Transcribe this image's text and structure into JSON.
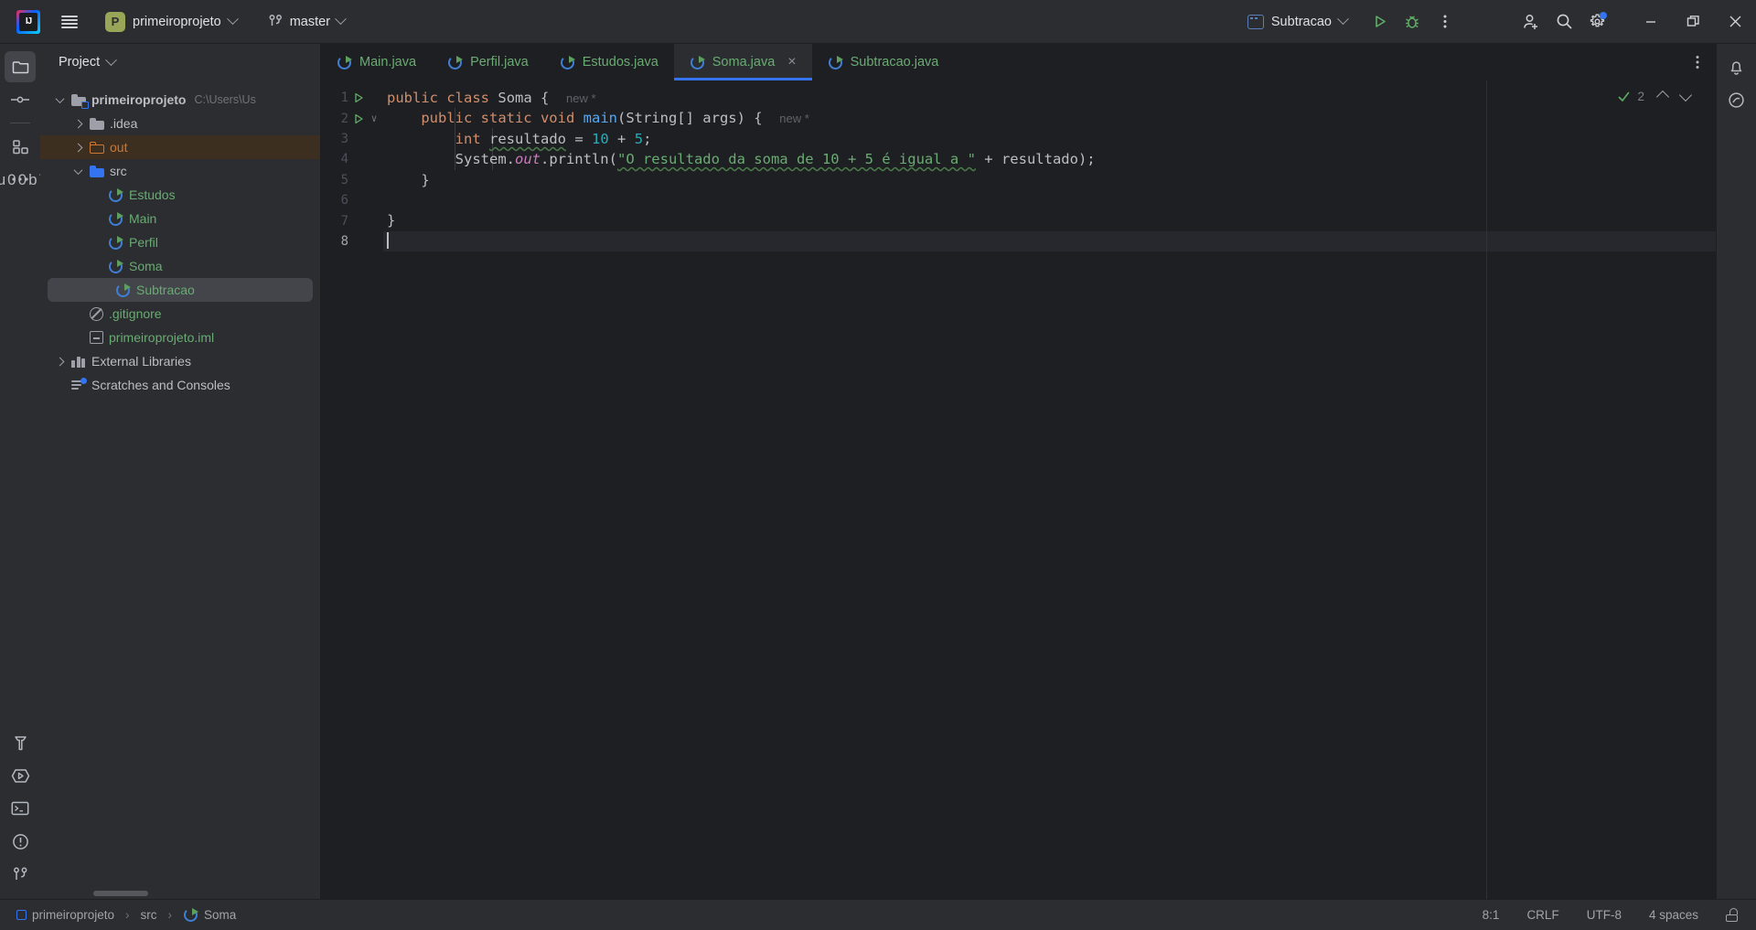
{
  "titlebar": {
    "logo_name": "intellij-idea-logo",
    "menu_label": "main-menu",
    "project_badge": "P",
    "project_name": "primeiroprojeto",
    "branch_name": "master",
    "run_config": "Subtracao",
    "run_label": "Run",
    "debug_label": "Debug",
    "more_label": "More Actions",
    "account_label": "Account",
    "search_label": "Search Everywhere",
    "settings_label": "Settings",
    "minimize_label": "Minimize",
    "maximize_label": "Maximize",
    "close_label": "Close"
  },
  "left_rail": {
    "top": [
      {
        "name": "project-tool-window",
        "icon": "folder-icon",
        "active": true
      },
      {
        "name": "commit-tool-window",
        "icon": "commit-icon",
        "active": false
      },
      {
        "name": "structure-tool-window",
        "icon": "structure-icon",
        "active": false
      },
      {
        "name": "more-tool-windows",
        "icon": "ellipsis-icon",
        "active": false
      }
    ],
    "bottom": [
      {
        "name": "build-tool-window",
        "icon": "hammer-icon"
      },
      {
        "name": "run-tool-window",
        "icon": "run-icon"
      },
      {
        "name": "terminal-tool-window",
        "icon": "terminal-icon"
      },
      {
        "name": "problems-tool-window",
        "icon": "warning-icon"
      },
      {
        "name": "version-control-tool-window",
        "icon": "branch-icon"
      }
    ]
  },
  "right_rail": [
    {
      "name": "notifications-tool-window",
      "icon": "bell-icon"
    },
    {
      "name": "ai-assistant-tool-window",
      "icon": "ai-icon"
    }
  ],
  "project_panel": {
    "title": "Project",
    "tree": [
      {
        "label": "primeiroprojeto",
        "suffix": "C:\\Users\\Us",
        "depth": 0,
        "icon": "module-folder-icon",
        "twisty": "open",
        "color": "grey",
        "state": "normal",
        "bold": true
      },
      {
        "label": ".idea",
        "suffix": "",
        "depth": 1,
        "icon": "folder-icon",
        "twisty": "closed",
        "color": "grey",
        "state": "normal",
        "bold": false
      },
      {
        "label": "out",
        "suffix": "",
        "depth": 1,
        "icon": "folder-orange-icon",
        "twisty": "closed",
        "color": "orange",
        "state": "highlighted",
        "bold": false
      },
      {
        "label": "src",
        "suffix": "",
        "depth": 1,
        "icon": "folder-blue-icon",
        "twisty": "open",
        "color": "grey",
        "state": "normal",
        "bold": false
      },
      {
        "label": "Estudos",
        "suffix": "",
        "depth": 2,
        "icon": "java-class-icon",
        "twisty": "none",
        "color": "green",
        "state": "normal",
        "bold": false
      },
      {
        "label": "Main",
        "suffix": "",
        "depth": 2,
        "icon": "java-class-icon",
        "twisty": "none",
        "color": "green",
        "state": "normal",
        "bold": false
      },
      {
        "label": "Perfil",
        "suffix": "",
        "depth": 2,
        "icon": "java-class-icon",
        "twisty": "none",
        "color": "green",
        "state": "normal",
        "bold": false
      },
      {
        "label": "Soma",
        "suffix": "",
        "depth": 2,
        "icon": "java-class-icon",
        "twisty": "none",
        "color": "green",
        "state": "normal",
        "bold": false
      },
      {
        "label": "Subtracao",
        "suffix": "",
        "depth": 2,
        "icon": "java-class-icon",
        "twisty": "none",
        "color": "green",
        "state": "selected",
        "bold": false
      },
      {
        "label": ".gitignore",
        "suffix": "",
        "depth": 1,
        "icon": "gitignore-icon",
        "twisty": "none",
        "color": "green",
        "state": "normal",
        "bold": false
      },
      {
        "label": "primeiroprojeto.iml",
        "suffix": "",
        "depth": 1,
        "icon": "iml-icon",
        "twisty": "none",
        "color": "green",
        "state": "normal",
        "bold": false
      },
      {
        "label": "External Libraries",
        "suffix": "",
        "depth": 0,
        "icon": "library-icon",
        "twisty": "closed",
        "color": "grey",
        "state": "normal",
        "bold": false
      },
      {
        "label": "Scratches and Consoles",
        "suffix": "",
        "depth": 0,
        "icon": "scratches-icon",
        "twisty": "none",
        "color": "grey",
        "state": "normal",
        "bold": false
      }
    ]
  },
  "editor": {
    "tabs": [
      {
        "label": "Main.java",
        "active": false,
        "closable": false
      },
      {
        "label": "Perfil.java",
        "active": false,
        "closable": false
      },
      {
        "label": "Estudos.java",
        "active": false,
        "closable": false
      },
      {
        "label": "Soma.java",
        "active": true,
        "closable": true
      },
      {
        "label": "Subtracao.java",
        "active": false,
        "closable": false
      }
    ],
    "close_glyph": "×",
    "inspection_count": "2",
    "lines": [
      {
        "num": "1",
        "run_marker": true,
        "fold": "",
        "current": false
      },
      {
        "num": "2",
        "run_marker": true,
        "fold": "∨",
        "current": false
      },
      {
        "num": "3",
        "run_marker": false,
        "fold": "",
        "current": false
      },
      {
        "num": "4",
        "run_marker": false,
        "fold": "",
        "current": false
      },
      {
        "num": "5",
        "run_marker": false,
        "fold": "",
        "current": false
      },
      {
        "num": "6",
        "run_marker": false,
        "fold": "",
        "current": false
      },
      {
        "num": "7",
        "run_marker": false,
        "fold": "",
        "current": false
      },
      {
        "num": "8",
        "run_marker": false,
        "fold": "",
        "current": true
      }
    ],
    "code": {
      "l1_kw_public": "public",
      "l1_kw_class": "class",
      "l1_name": "Soma",
      "l1_brace": "{",
      "l1_hint": "new *",
      "l2_kw": "public static void",
      "l2_name": "main",
      "l2_args": "(String[] args) {",
      "l2_hint": "new *",
      "l3_kw": "int",
      "l3_var": "resultado",
      "l3_eq": "=",
      "l3_a": "10",
      "l3_plus": "+",
      "l3_b": "5",
      "l3_semi": ";",
      "l4_sys": "System.",
      "l4_out": "out",
      "l4_print": ".println(",
      "l4_str": "\"O resultado da soma de 10 + 5 é igual a \"",
      "l4_concat": "+",
      "l4_var": "resultado",
      "l4_end": ");",
      "l5_brace": "}",
      "l7_brace": "}"
    }
  },
  "statusbar": {
    "breadcrumbs": [
      "primeiroprojeto",
      "src",
      "Soma"
    ],
    "separator": "›",
    "caret_position": "8:1",
    "line_separator": "CRLF",
    "encoding": "UTF-8",
    "indent": "4 spaces",
    "lock_label": "read-only-toggle"
  },
  "colors": {
    "accent_blue": "#3574f0",
    "keyword_orange": "#cf8e6d",
    "string_green": "#6aab73",
    "number_cyan": "#2aacb8",
    "field_purple": "#c77dbb",
    "titlebar_bg": "#2b2d30",
    "editor_bg": "#1e1f22"
  }
}
